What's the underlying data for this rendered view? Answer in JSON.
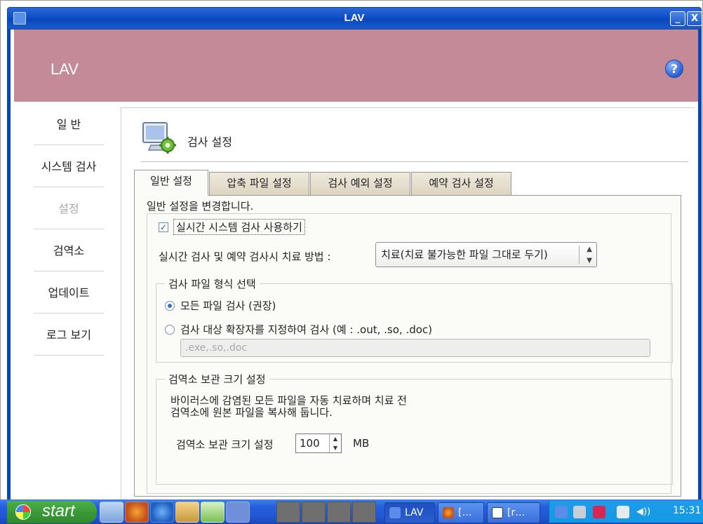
{
  "window": {
    "title": "LAV",
    "minimize_label": "_",
    "close_label": "X"
  },
  "header": {
    "brand": "LAV",
    "help_label": "?"
  },
  "sidebar": {
    "items": [
      {
        "label": "일 반",
        "state": "normal"
      },
      {
        "label": "시스템 검사",
        "state": "normal"
      },
      {
        "label": "설정",
        "state": "disabled"
      },
      {
        "label": "검역소",
        "state": "normal"
      },
      {
        "label": "업데이트",
        "state": "normal"
      },
      {
        "label": "로그 보기",
        "state": "normal"
      }
    ]
  },
  "page": {
    "title": "검사 설정",
    "icon": "monitor-gear-icon"
  },
  "tabs": [
    {
      "label": "일반 설정",
      "active": true
    },
    {
      "label": "압축 파일 설정",
      "active": false
    },
    {
      "label": "검사 예외 설정",
      "active": false
    },
    {
      "label": "예약 검사 설정",
      "active": false
    }
  ],
  "general": {
    "description": "일반 설정을 변경합니다.",
    "realtime_checkbox": {
      "label": "실시간 시스템 검사 사용하기",
      "checked": true
    },
    "treatment": {
      "label": "실시간 검사 및 예약 검사시 치료 방법 :",
      "selected": "치료(치료 불가능한 파일 그대로 두기)"
    },
    "file_type": {
      "legend": "검사 파일 형식 선택",
      "option_all": "모든 파일 검사 (권장)",
      "option_ext": "검사 대상 확장자를 지정하여 검사 (예 : .out, .so, .doc)",
      "selected": "all",
      "ext_placeholder": ".exe,.so,.doc"
    },
    "quarantine": {
      "legend": "검역소 보관 크기 설정",
      "description": "바이러스에 감염된 모든 파일을 자동 치료하며 치료 전\n검역소에 원본 파일을 복사해 둡니다.",
      "size_label": "검역소 보관 크기 설정",
      "size_value": "100",
      "unit": "MB"
    }
  },
  "taskbar": {
    "start_label": "start",
    "tasks": [
      {
        "label": "LAV",
        "active": true
      },
      {
        "label": "[…",
        "active": false
      },
      {
        "label": "[r…",
        "active": false
      }
    ],
    "clock": "15:31",
    "colors": {
      "taskbar": "#245edb",
      "start": "#3a9a37",
      "tray": "#139ae4"
    }
  },
  "colors": {
    "header_band": "#c58a97",
    "titlebar": "#0f4fc6",
    "help_icon": "#2a5fd0"
  }
}
